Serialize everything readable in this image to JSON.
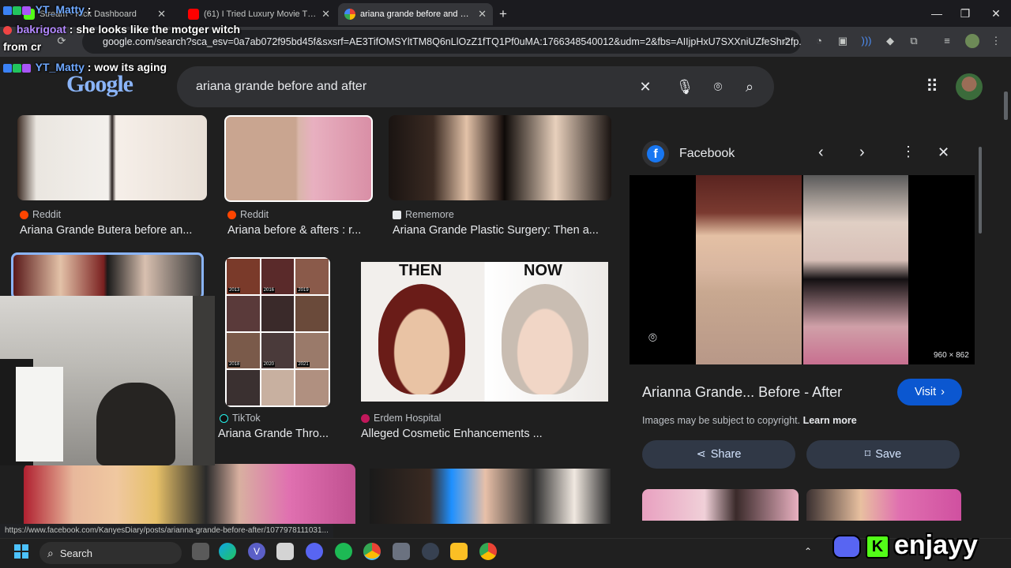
{
  "browser": {
    "tabs": [
      {
        "title": "Stream - Kick Dashboard",
        "active": false
      },
      {
        "title": "(61) I Tried Luxury Movie Theat",
        "active": false
      },
      {
        "title": "ariana grande before and after",
        "active": true
      }
    ],
    "new_tab": "+",
    "url": "google.com/search?sca_esv=0a7ab072f95bd45f&sxsrf=AE3TifOMSYltTM8Q6nLlOzZ1fTQ1Pf0uMA:1766348540012&udm=2&fbs=AIIjpHxU7SXXniUZfeShr2fp..."
  },
  "chat": [
    {
      "user": "YT_Matty",
      "text": ":",
      "color": "#6ea8ff"
    },
    {
      "user": "bakrigoat",
      "text": ": she looks like the motger witch",
      "color": "#b388ff"
    },
    {
      "user": "",
      "text": "from cr",
      "color": "#ffffff"
    },
    {
      "user": "YT_Matty",
      "text": ": wow its aging",
      "color": "#6ea8ff"
    }
  ],
  "google": {
    "logo": "Google",
    "query": "ariana grande before and after"
  },
  "results": [
    {
      "source": "Reddit",
      "title": "Ariana Grande Butera before an...",
      "icon": "reddit-icon"
    },
    {
      "source": "Reddit",
      "title": "Ariana before & afters : r...",
      "icon": "reddit-icon"
    },
    {
      "source": "Rememore",
      "title": "Ariana Grande Plastic Surgery: Then a...",
      "icon": "rememore-icon"
    },
    {
      "source": "TikTok",
      "title": "Ariana Grande Thro...",
      "icon": "tiktok-icon"
    },
    {
      "source": "Erdem Hospital",
      "title": "Alleged Cosmetic Enhancements ...",
      "icon": "erdem-icon"
    }
  ],
  "then_now": {
    "then": "THEN",
    "now": "NOW"
  },
  "collage_years": [
    "2013",
    "2016",
    "2019",
    "2018",
    "2020",
    "2021"
  ],
  "panel": {
    "source": "Facebook",
    "dimensions": "960 × 862",
    "title": "Arianna Grande... Before - After",
    "visit": "Visit",
    "copyright": "Images may be subject to copyright.",
    "learn_more": "Learn more",
    "share": "Share",
    "save": "Save"
  },
  "status_url": "https://www.facebook.com/KanyesDiary/posts/arianna-grande-before-after/1077978111031...",
  "taskbar": {
    "search": "Search"
  },
  "overlay_brand": "enjayy"
}
